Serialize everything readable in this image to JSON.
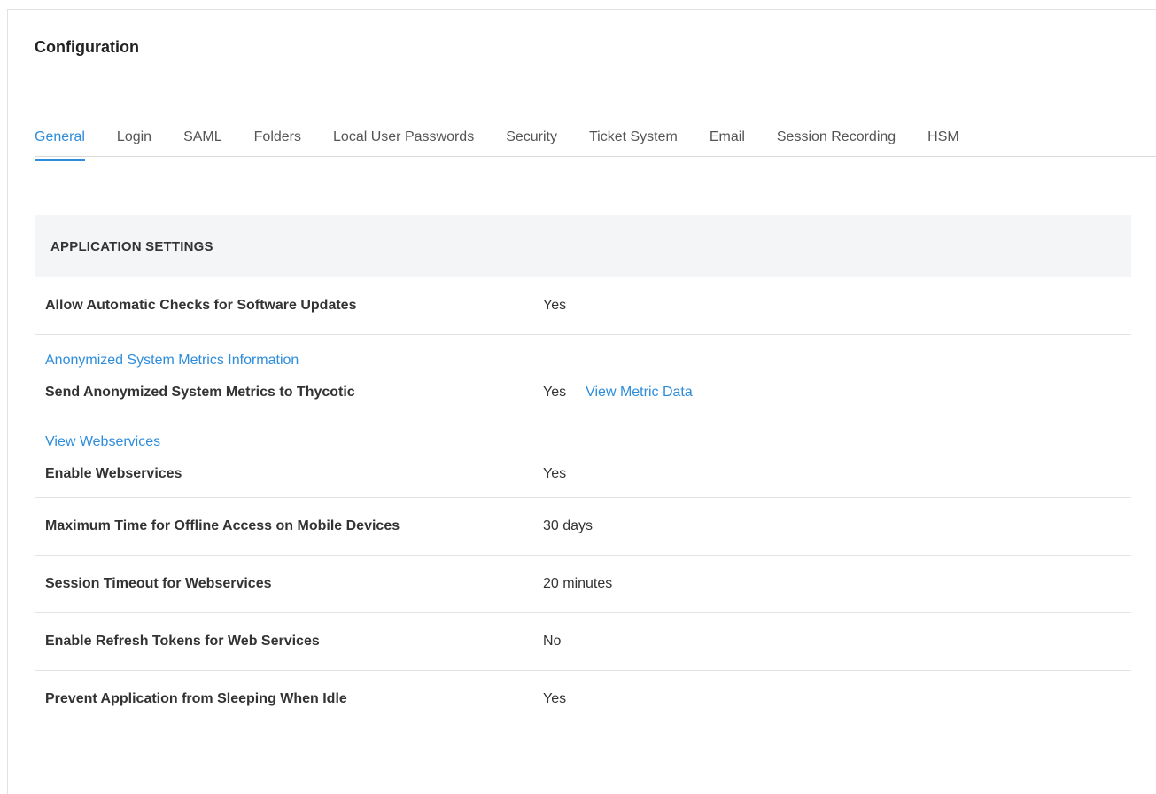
{
  "page": {
    "title": "Configuration"
  },
  "tabs": [
    {
      "label": "General",
      "active": true
    },
    {
      "label": "Login"
    },
    {
      "label": "SAML"
    },
    {
      "label": "Folders"
    },
    {
      "label": "Local User Passwords"
    },
    {
      "label": "Security"
    },
    {
      "label": "Ticket System"
    },
    {
      "label": "Email"
    },
    {
      "label": "Session Recording"
    },
    {
      "label": "HSM"
    }
  ],
  "section": {
    "title": "APPLICATION SETTINGS"
  },
  "settings": {
    "auto_updates": {
      "label": "Allow Automatic Checks for Software Updates",
      "value": "Yes"
    },
    "metrics_group_link": "Anonymized System Metrics Information",
    "send_metrics": {
      "label": "Send Anonymized System Metrics to Thycotic",
      "value": "Yes",
      "link": "View Metric Data"
    },
    "webservices_group_link": "View Webservices",
    "enable_webservices": {
      "label": "Enable Webservices",
      "value": "Yes"
    },
    "offline_access": {
      "label": "Maximum Time for Offline Access on Mobile Devices",
      "value": "30 days"
    },
    "session_timeout": {
      "label": "Session Timeout for Webservices",
      "value": "20 minutes"
    },
    "refresh_tokens": {
      "label": "Enable Refresh Tokens for Web Services",
      "value": "No"
    },
    "prevent_sleep": {
      "label": "Prevent Application from Sleeping When Idle",
      "value": "Yes"
    }
  },
  "colors": {
    "accent": "#2e8ddb",
    "section_bg": "#f4f5f6",
    "divider": "#e3e3e3"
  }
}
